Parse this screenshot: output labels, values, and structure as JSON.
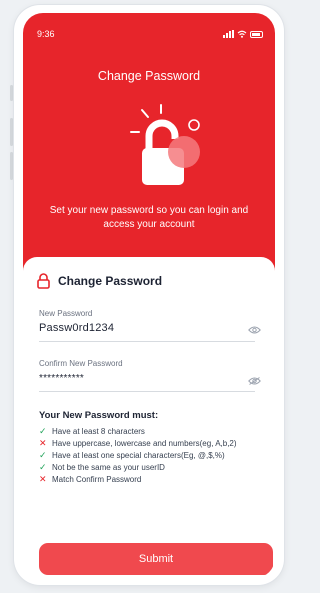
{
  "status_bar": {
    "time": "9:36"
  },
  "header": {
    "title": "Change Password",
    "description": "Set your new password so you can login and access your account"
  },
  "card": {
    "title": "Change Password",
    "new_password": {
      "label": "New Password",
      "value": "Passw0rd1234"
    },
    "confirm_password": {
      "label": "Confirm New Password",
      "value": "***********"
    }
  },
  "requirements": {
    "title": "Your New Password must:",
    "items": [
      {
        "text": "Have at least 8 characters",
        "status": "met"
      },
      {
        "text": "Have uppercase, lowercase and numbers(eg, A,b,2)",
        "status": "unmet"
      },
      {
        "text": "Have at least one special characters(Eg, @,$,%)",
        "status": "met"
      },
      {
        "text": "Not be the same as your userID",
        "status": "met"
      },
      {
        "text": "Match Confirm Password",
        "status": "unmet"
      }
    ]
  },
  "submit_label": "Submit",
  "colors": {
    "primary_red": "#e7252b",
    "button_red": "#f0494e",
    "check_green": "#22a35a"
  },
  "icons": {
    "met": "check-icon",
    "unmet": "cross-icon",
    "header": "lock-icon",
    "card_title": "lock-outline-icon",
    "field_toggle": "eye-icon"
  },
  "marks": {
    "met": "✓",
    "unmet": "✕"
  }
}
